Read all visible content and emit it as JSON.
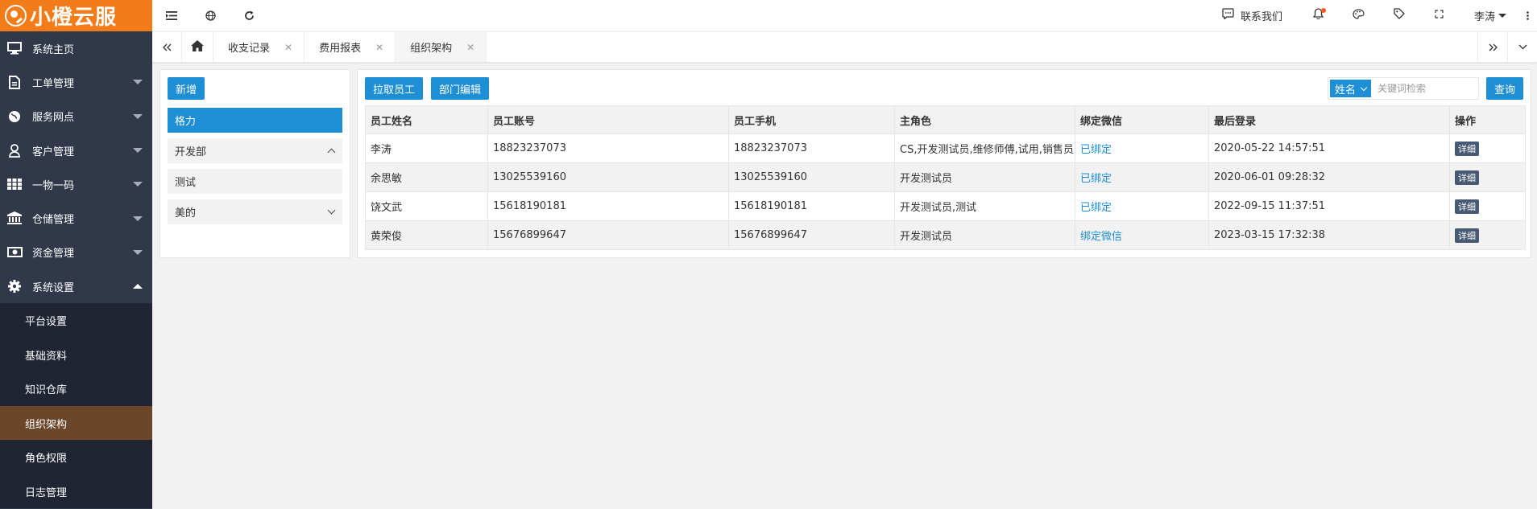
{
  "brand": {
    "name": "小橙云服"
  },
  "sidebar": {
    "menu": [
      {
        "label": "系统主页",
        "icon": "monitor-icon",
        "expandable": false
      },
      {
        "label": "工单管理",
        "icon": "document-icon",
        "expandable": true
      },
      {
        "label": "服务网点",
        "icon": "globe-icon",
        "expandable": true
      },
      {
        "label": "客户管理",
        "icon": "user-icon",
        "expandable": true
      },
      {
        "label": "一物一码",
        "icon": "grid-icon",
        "expandable": true
      },
      {
        "label": "仓储管理",
        "icon": "bank-icon",
        "expandable": true
      },
      {
        "label": "资金管理",
        "icon": "money-icon",
        "expandable": true
      },
      {
        "label": "系统设置",
        "icon": "gear-icon",
        "expandable": true,
        "expanded": true
      }
    ],
    "submenu": [
      {
        "label": "平台设置"
      },
      {
        "label": "基础资料"
      },
      {
        "label": "知识仓库"
      },
      {
        "label": "组织架构",
        "active": true
      },
      {
        "label": "角色权限"
      },
      {
        "label": "日志管理"
      }
    ]
  },
  "header": {
    "contact_label": "联系我们",
    "user_name": "李涛"
  },
  "tabs": [
    {
      "label": "收支记录"
    },
    {
      "label": "费用报表"
    },
    {
      "label": "组织架构",
      "active": true
    }
  ],
  "dept_panel": {
    "add_button": "新增",
    "root": "格力",
    "departments": [
      {
        "label": "开发部",
        "state": "expanded"
      },
      {
        "label": "测试",
        "state": "none"
      },
      {
        "label": "美的",
        "state": "collapsed"
      }
    ]
  },
  "employee_panel": {
    "pull_button": "拉取员工",
    "edit_dept_button": "部门编辑",
    "search": {
      "field": "姓名",
      "placeholder": "关键词检索",
      "query_button": "查询"
    },
    "columns": [
      "员工姓名",
      "员工账号",
      "员工手机",
      "主角色",
      "绑定微信",
      "最后登录",
      "操作"
    ],
    "rows": [
      {
        "name": "李涛",
        "account": "18823237073",
        "phone": "18823237073",
        "role": "CS,开发测试员,维修师傅,试用,销售员",
        "wechat": "已绑定",
        "last_login": "2020-05-22 14:57:51",
        "action": "详细"
      },
      {
        "name": "余思敏",
        "account": "13025539160",
        "phone": "13025539160",
        "role": "开发测试员",
        "wechat": "已绑定",
        "last_login": "2020-06-01 09:28:32",
        "action": "详细"
      },
      {
        "name": "饶文武",
        "account": "15618190181",
        "phone": "15618190181",
        "role": "开发测试员,测试",
        "wechat": "已绑定",
        "last_login": "2022-09-15 11:37:51",
        "action": "详细"
      },
      {
        "name": "黄荣俊",
        "account": "15676899647",
        "phone": "15676899647",
        "role": "开发测试员",
        "wechat": "绑定微信",
        "last_login": "2023-03-15 17:32:38",
        "action": "详细"
      }
    ]
  },
  "colors": {
    "brand_orange": "#f27c1a",
    "sidebar_bg": "#30384a",
    "primary_blue": "#1e8ed6",
    "active_submenu": "#6b4629",
    "notification_dot": "#ff5722"
  }
}
